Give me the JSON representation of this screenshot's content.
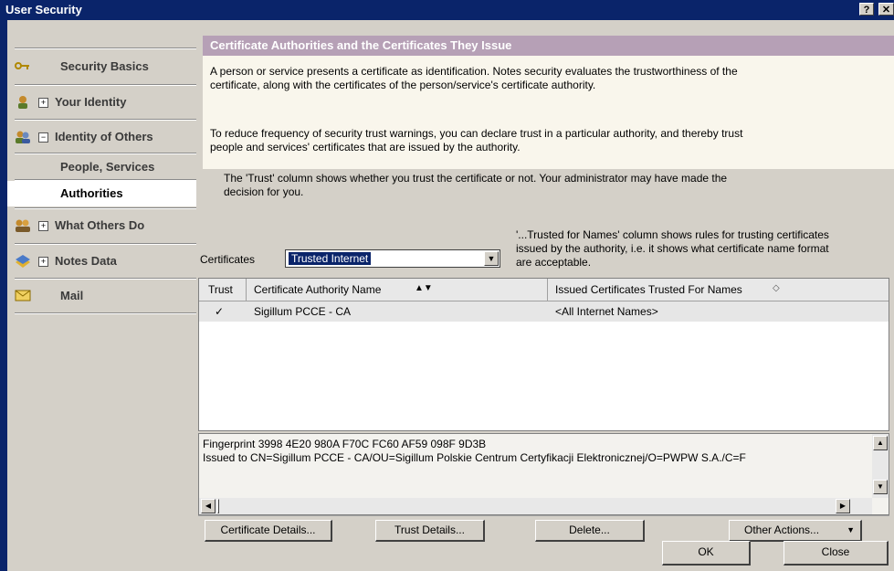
{
  "window": {
    "title": "User Security",
    "help_label": "?",
    "close_label": "✕"
  },
  "sidebar": {
    "items": [
      {
        "label": "Security Basics",
        "icon": "key-icon"
      },
      {
        "label": "Your Identity",
        "icon": "person-icon",
        "expander": "+"
      },
      {
        "label": "Identity of Others",
        "icon": "people-icon",
        "expander": "−"
      },
      {
        "label": "People, Services"
      },
      {
        "label": "Authorities"
      },
      {
        "label": "What Others Do",
        "icon": "group-icon",
        "expander": "+"
      },
      {
        "label": "Notes Data",
        "icon": "database-icon",
        "expander": "+"
      },
      {
        "label": "Mail",
        "icon": "envelope-icon"
      }
    ]
  },
  "header": {
    "title": "Certificate Authorities and the Certificates They Issue"
  },
  "description": {
    "p1_line1": "A person or service presents a certificate as identification. Notes security evaluates the trustworthiness of the",
    "p1_line2": "certificate, along with the certificates of the person/service's certificate authority.",
    "p2_line1": "To reduce frequency of security trust warnings, you can declare trust in a particular authority, and thereby trust",
    "p2_line2": "people and services' certificates that are issued by the authority."
  },
  "info": {
    "trust_line1": "The 'Trust' column shows whether you trust the certificate or not. Your administrator may have made the",
    "trust_line2": "decision for you.",
    "names_line1": "'...Trusted for Names' column shows rules for trusting certificates",
    "names_line2": "issued by the authority, i.e. it shows what certificate name format",
    "names_line3": "are acceptable."
  },
  "certificates": {
    "label": "Certificates",
    "selected": "Trusted Internet"
  },
  "table": {
    "columns": [
      "Trust",
      "Certificate Authority Name",
      "Issued Certificates Trusted For Names"
    ],
    "rows": [
      {
        "trust": "✓",
        "name": "Sigillum PCCE - CA",
        "names": "<All Internet Names>"
      }
    ]
  },
  "details": {
    "fingerprint": "Fingerprint  3998 4E20 980A F70C FC60 AF59 098F 9D3B",
    "issued_to": "Issued to  CN=Sigillum PCCE - CA/OU=Sigillum Polskie Centrum Certyfikacji Elektronicznej/O=PWPW S.A./C=F"
  },
  "buttons": {
    "certificate_details": "Certificate Details...",
    "trust_details": "Trust Details...",
    "delete": "Delete...",
    "other_actions": "Other Actions...",
    "ok": "OK",
    "close": "Close"
  },
  "colors": {
    "titlebar": "#0a246a",
    "header": "#b6a0b6",
    "description_bg": "#f9f6ec",
    "selection": "#0a246a"
  }
}
